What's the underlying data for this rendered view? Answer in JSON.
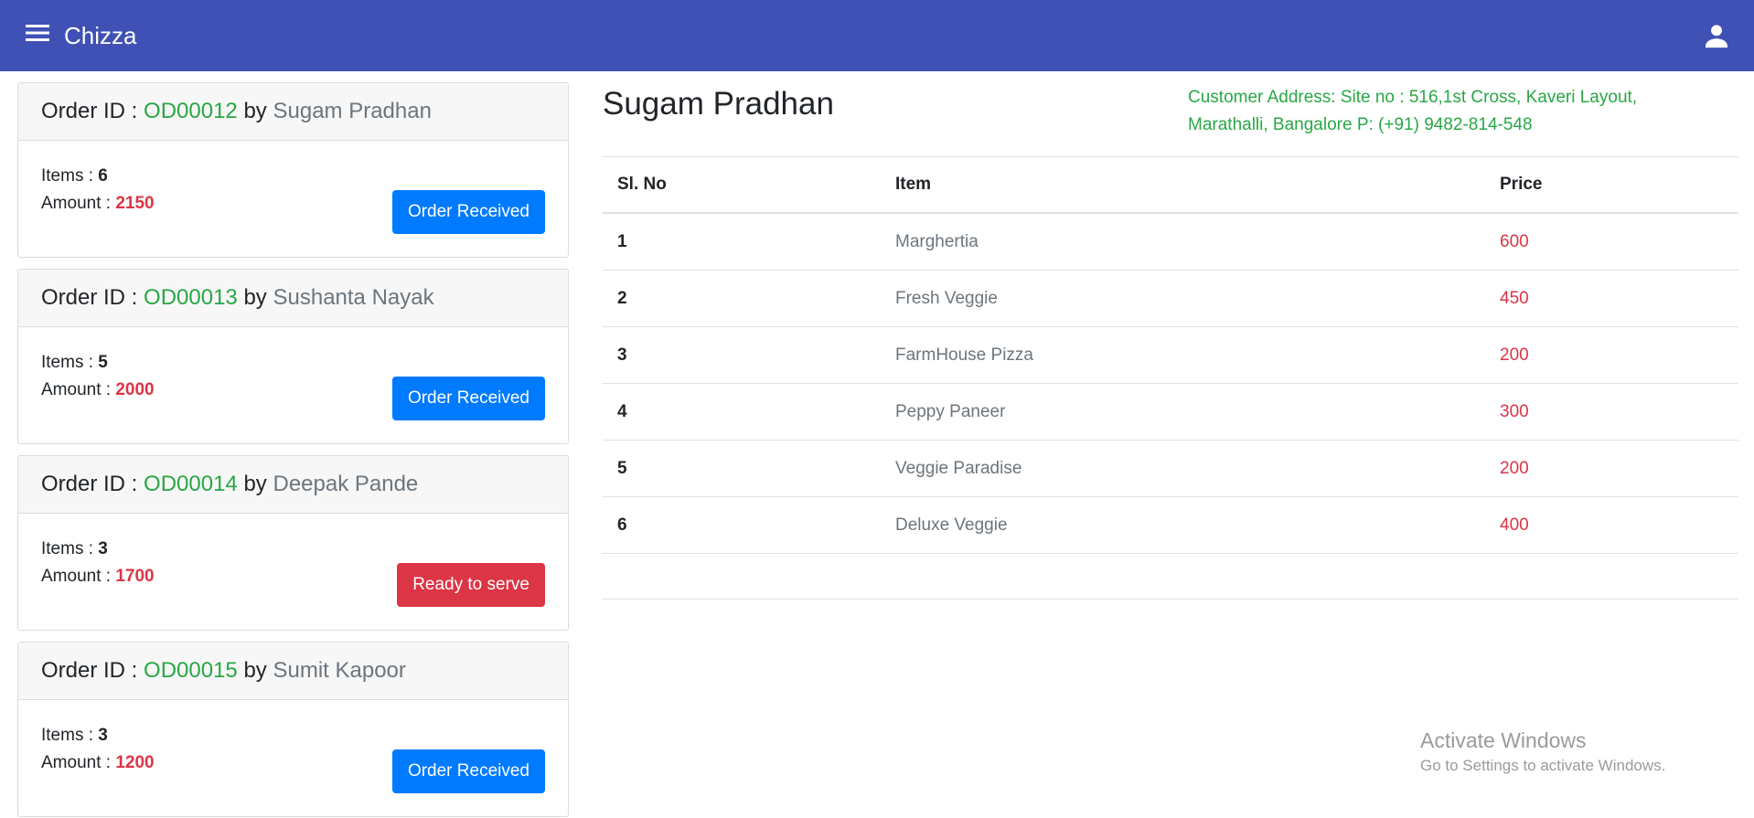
{
  "app": {
    "title": "Chizza"
  },
  "orders": [
    {
      "prefix": "Order ID : ",
      "id": "OD00012",
      "by": " by ",
      "customer": "Sugam Pradhan",
      "items_label": "Items : ",
      "items": "6",
      "amount_label": "Amount : ",
      "amount": "2150",
      "status": "Order Received"
    },
    {
      "prefix": "Order ID : ",
      "id": "OD00013",
      "by": " by ",
      "customer": "Sushanta Nayak",
      "items_label": "Items : ",
      "items": "5",
      "amount_label": "Amount : ",
      "amount": "2000",
      "status": "Order Received"
    },
    {
      "prefix": "Order ID : ",
      "id": "OD00014",
      "by": " by ",
      "customer": "Deepak Pande",
      "items_label": "Items : ",
      "items": "3",
      "amount_label": "Amount : ",
      "amount": "1700",
      "status": "Ready to serve"
    },
    {
      "prefix": "Order ID : ",
      "id": "OD00015",
      "by": " by ",
      "customer": "Sumit Kapoor",
      "items_label": "Items : ",
      "items": "3",
      "amount_label": "Amount : ",
      "amount": "1200",
      "status": "Order Received"
    }
  ],
  "detail": {
    "customer_name": "Sugam Pradhan",
    "address": "Customer Address: Site no : 516,1st Cross, Kaveri Layout, Marathalli, Bangalore P: (+91) 9482-814-548",
    "columns": [
      "Sl. No",
      "Item",
      "Price"
    ],
    "rows": [
      {
        "sl": "1",
        "item": "Marghertia",
        "price": "600"
      },
      {
        "sl": "2",
        "item": "Fresh Veggie",
        "price": "450"
      },
      {
        "sl": "3",
        "item": "FarmHouse Pizza",
        "price": "200"
      },
      {
        "sl": "4",
        "item": "Peppy Paneer",
        "price": "300"
      },
      {
        "sl": "5",
        "item": "Veggie Paradise",
        "price": "200"
      },
      {
        "sl": "6",
        "item": "Deluxe Veggie",
        "price": "400"
      }
    ]
  },
  "watermark": {
    "title": "Activate Windows",
    "subtitle": "Go to Settings to activate Windows."
  },
  "icons": {
    "menu": "menu-icon",
    "account": "account-icon"
  },
  "colors": {
    "appbar": "#3f51b5",
    "primary": "#007bff",
    "danger": "#dc3545",
    "success": "#28a745"
  }
}
